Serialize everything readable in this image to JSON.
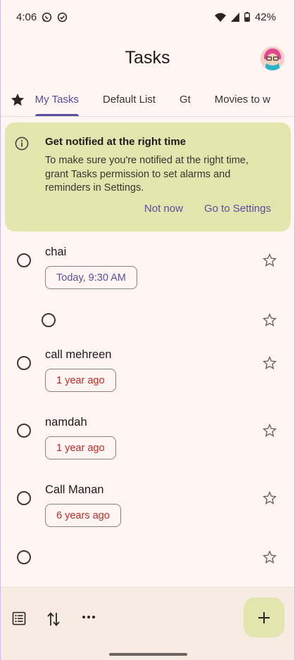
{
  "status_bar": {
    "time": "4:06",
    "battery": "42%",
    "icons": [
      "whatsapp-icon",
      "check-circle-icon",
      "wifi-icon",
      "signal-icon",
      "battery-icon"
    ]
  },
  "app": {
    "title": "Tasks",
    "accent_color": "#5b4d9f",
    "banner_color": "#e2e6ae",
    "overdue_color": "#c62a22"
  },
  "tabs": [
    {
      "label": "My Tasks",
      "active": true
    },
    {
      "label": "Default List",
      "active": false
    },
    {
      "label": "Gt",
      "active": false
    },
    {
      "label": "Movies to w",
      "active": false
    }
  ],
  "banner": {
    "title": "Get notified at the right time",
    "body": "To make sure you're notified at the right time, grant Tasks permission to set alarms and reminders in Settings.",
    "dismiss_label": "Not now",
    "action_label": "Go to Settings"
  },
  "tasks": [
    {
      "title": "chai",
      "chip": "Today, 9:30 AM",
      "chip_status": "normal"
    },
    {
      "title": "",
      "chip": "",
      "chip_status": "",
      "subtask": true
    },
    {
      "title": "call mehreen",
      "chip": "1 year ago",
      "chip_status": "overdue"
    },
    {
      "title": "namdah",
      "chip": "1 year ago",
      "chip_status": "overdue"
    },
    {
      "title": "Call Manan",
      "chip": "6 years ago",
      "chip_status": "overdue"
    },
    {
      "title": "",
      "chip": "",
      "chip_status": ""
    }
  ],
  "bottom_bar": {
    "icons": [
      "list-view-icon",
      "sort-icon",
      "more-icon"
    ],
    "fab_icon": "plus-icon"
  }
}
